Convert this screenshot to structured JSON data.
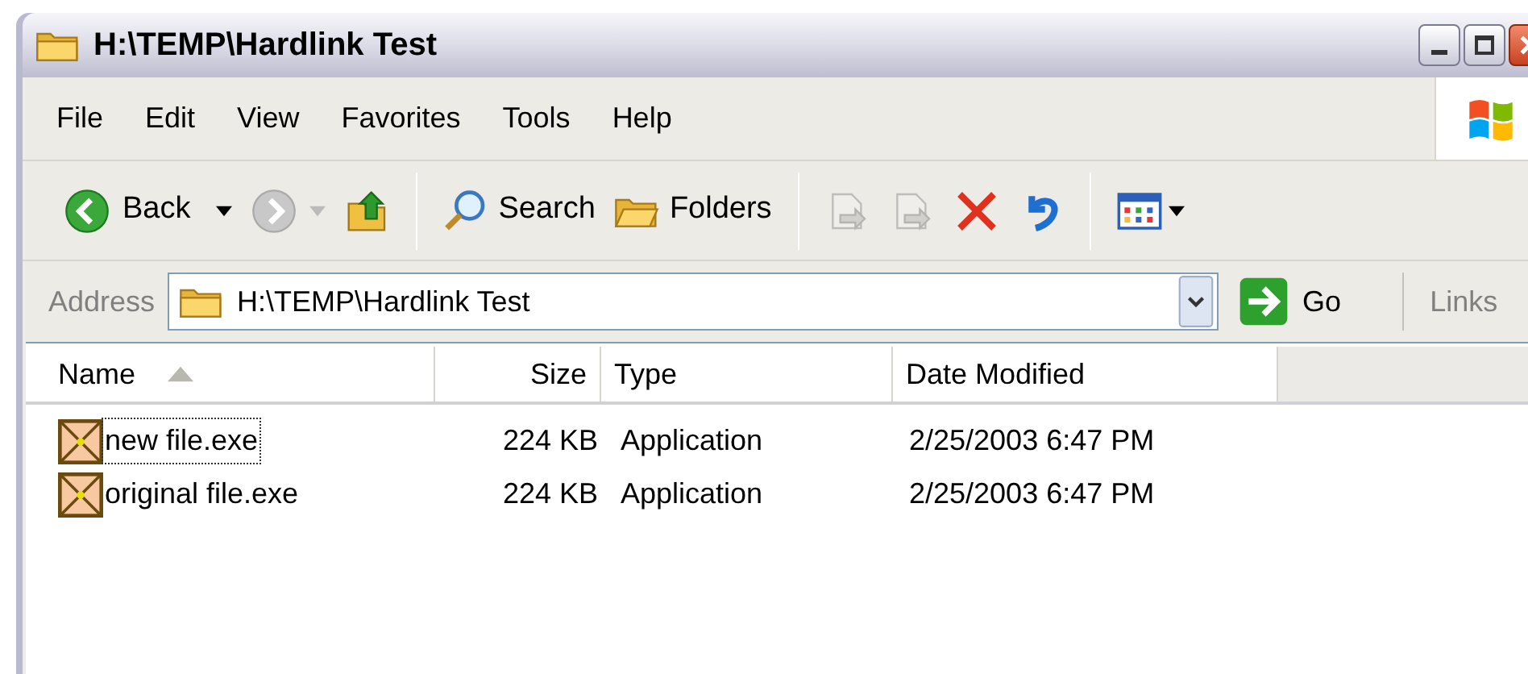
{
  "window": {
    "title": "H:\\TEMP\\Hardlink Test"
  },
  "menu": [
    "File",
    "Edit",
    "View",
    "Favorites",
    "Tools",
    "Help"
  ],
  "toolbar": [
    {
      "kind": "back",
      "label": "Back",
      "disabled": false
    },
    {
      "kind": "forward",
      "disabled": true
    },
    {
      "kind": "up",
      "disabled": false
    },
    {
      "kind": "separator"
    },
    {
      "kind": "search",
      "label": "Search",
      "disabled": false
    },
    {
      "kind": "folders",
      "label": "Folders",
      "disabled": false
    },
    {
      "kind": "separator"
    },
    {
      "kind": "move-to",
      "disabled": true
    },
    {
      "kind": "copy-to",
      "disabled": true
    },
    {
      "kind": "delete",
      "disabled": false
    },
    {
      "kind": "undo",
      "disabled": false
    },
    {
      "kind": "separator"
    },
    {
      "kind": "views",
      "disabled": false
    }
  ],
  "address": {
    "label": "Address",
    "value": "H:\\TEMP\\Hardlink Test",
    "go": "Go",
    "links": "Links"
  },
  "columns": [
    {
      "label": "Name",
      "sorted": true
    },
    {
      "label": "Size",
      "sorted": false
    },
    {
      "label": "Type",
      "sorted": false
    },
    {
      "label": "Date Modified",
      "sorted": false
    }
  ],
  "rows": [
    {
      "name": "new file.exe",
      "size": "224 KB",
      "type": "Application",
      "date": "2/25/2003 6:47 PM",
      "focused": true
    },
    {
      "name": "original file.exe",
      "size": "224 KB",
      "type": "Application",
      "date": "2/25/2003 6:47 PM",
      "focused": false
    }
  ]
}
